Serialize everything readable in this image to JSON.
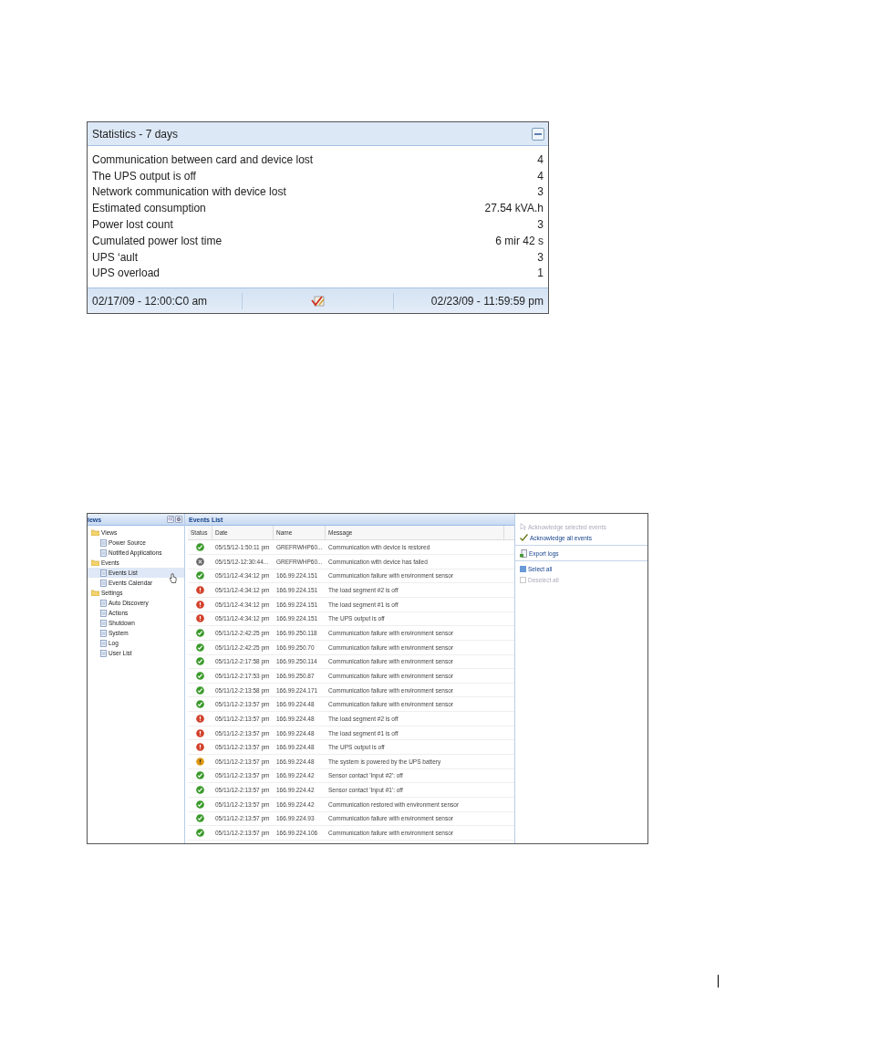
{
  "statistics": {
    "title": "Statistics - 7 days",
    "rows": [
      {
        "label": "Communication between card and device lost",
        "value": "4"
      },
      {
        "label": "The UPS output is off",
        "value": "4"
      },
      {
        "label": "Network communication with device lost",
        "value": "3"
      },
      {
        "label": "Estimated consumption",
        "value": "27.54 kVA.h"
      },
      {
        "label": "Power lost count",
        "value": "3"
      },
      {
        "label": "Cumulated power lost time",
        "value": "6 mir 42 s"
      },
      {
        "label": "UPS ‘ault",
        "value": "3"
      },
      {
        "label": "UPS overload",
        "value": "1"
      }
    ],
    "start": "02/17/09 - 12:00:C0 am",
    "end": "02/23/09 - 11:59:59 pm"
  },
  "sidebar": {
    "title": "iews",
    "items": [
      {
        "label": "Views",
        "children": [
          {
            "label": "Power Source",
            "selected": false
          },
          {
            "label": "Notified Applications",
            "selected": false
          }
        ]
      },
      {
        "label": "Events",
        "children": [
          {
            "label": "Events List",
            "selected": true
          },
          {
            "label": "Events Calendar",
            "selected": false
          }
        ]
      },
      {
        "label": "Settings",
        "children": [
          {
            "label": "Auto Discovery",
            "selected": false
          },
          {
            "label": "Actions",
            "selected": false
          },
          {
            "label": "Shutdown",
            "selected": false
          },
          {
            "label": "System",
            "selected": false
          },
          {
            "label": "Log",
            "selected": false
          },
          {
            "label": "User List",
            "selected": false
          }
        ]
      }
    ]
  },
  "events": {
    "title": "Events List",
    "columns": [
      "Status",
      "Date",
      "Name",
      "Message"
    ],
    "rows": [
      {
        "kind": "ok",
        "date": "05/15/12-1:50:11 pm",
        "name": "GREFRWHP60...",
        "message": "Communication with device is restored"
      },
      {
        "kind": "failed",
        "date": "05/15/12-12:30:44...",
        "name": "GREFRWHP60...",
        "message": "Communication with device has failed"
      },
      {
        "kind": "ok",
        "date": "05/11/12-4:34:12 pm",
        "name": "166.99.224.151",
        "message": "Communication failure with environment sensor"
      },
      {
        "kind": "error",
        "date": "05/11/12-4:34:12 pm",
        "name": "166.99.224.151",
        "message": "The load segment #2 is off"
      },
      {
        "kind": "error",
        "date": "05/11/12-4:34:12 pm",
        "name": "166.99.224.151",
        "message": "The load segment #1 is off"
      },
      {
        "kind": "error",
        "date": "05/11/12-4:34:12 pm",
        "name": "166.99.224.151",
        "message": "The UPS output is off"
      },
      {
        "kind": "ok",
        "date": "05/11/12-2:42:25 pm",
        "name": "166.99.250.118",
        "message": "Communication failure with environment sensor"
      },
      {
        "kind": "ok",
        "date": "05/11/12-2:42:25 pm",
        "name": "166.99.250.70",
        "message": "Communication failure with environment sensor"
      },
      {
        "kind": "ok",
        "date": "05/11/12-2:17:58 pm",
        "name": "166.99.250.114",
        "message": "Communication failure with environment sensor"
      },
      {
        "kind": "ok",
        "date": "05/11/12-2:17:53 pm",
        "name": "166.99.250.87",
        "message": "Communication failure with environment sensor"
      },
      {
        "kind": "ok",
        "date": "05/11/12-2:13:58 pm",
        "name": "166.99.224.171",
        "message": "Communication failure with environment sensor"
      },
      {
        "kind": "ok",
        "date": "05/11/12-2:13:57 pm",
        "name": "166.99.224.48",
        "message": "Communication failure with environment sensor"
      },
      {
        "kind": "error",
        "date": "05/11/12-2:13:57 pm",
        "name": "166.99.224.48",
        "message": "The load segment #2 is off"
      },
      {
        "kind": "error",
        "date": "05/11/12-2:13:57 pm",
        "name": "166.99.224.48",
        "message": "The load segment #1 is off"
      },
      {
        "kind": "error",
        "date": "05/11/12-2:13:57 pm",
        "name": "166.99.224.48",
        "message": "The UPS output is off"
      },
      {
        "kind": "warning",
        "date": "05/11/12-2:13:57 pm",
        "name": "166.99.224.48",
        "message": "The system is powered by the UPS battery"
      },
      {
        "kind": "ok",
        "date": "05/11/12-2:13:57 pm",
        "name": "166.99.224.42",
        "message": "Sensor contact 'Input #2': off"
      },
      {
        "kind": "ok",
        "date": "05/11/12-2:13:57 pm",
        "name": "166.99.224.42",
        "message": "Sensor contact 'Input #1': off"
      },
      {
        "kind": "ok",
        "date": "05/11/12-2:13:57 pm",
        "name": "166.99.224.42",
        "message": "Communication restored with environment sensor"
      },
      {
        "kind": "ok",
        "date": "05/11/12-2:13:57 pm",
        "name": "166.99.224.93",
        "message": "Communication failure with environment sensor"
      },
      {
        "kind": "ok",
        "date": "05/11/12-2:13:57 pm",
        "name": "166.99.224.106",
        "message": "Communication failure with environment sensor"
      }
    ]
  },
  "actions": [
    {
      "kind": "acknowledge",
      "label": "Acknowledge selected events",
      "disabled": true
    },
    {
      "kind": "acknowledge-all",
      "label": "Acknowledge all events",
      "disabled": false
    },
    {
      "kind": "export",
      "label": "Export logs",
      "disabled": false
    },
    {
      "kind": "select",
      "label": "Select all",
      "disabled": false
    },
    {
      "kind": "deselect",
      "label": "Deselect all",
      "disabled": true
    }
  ]
}
